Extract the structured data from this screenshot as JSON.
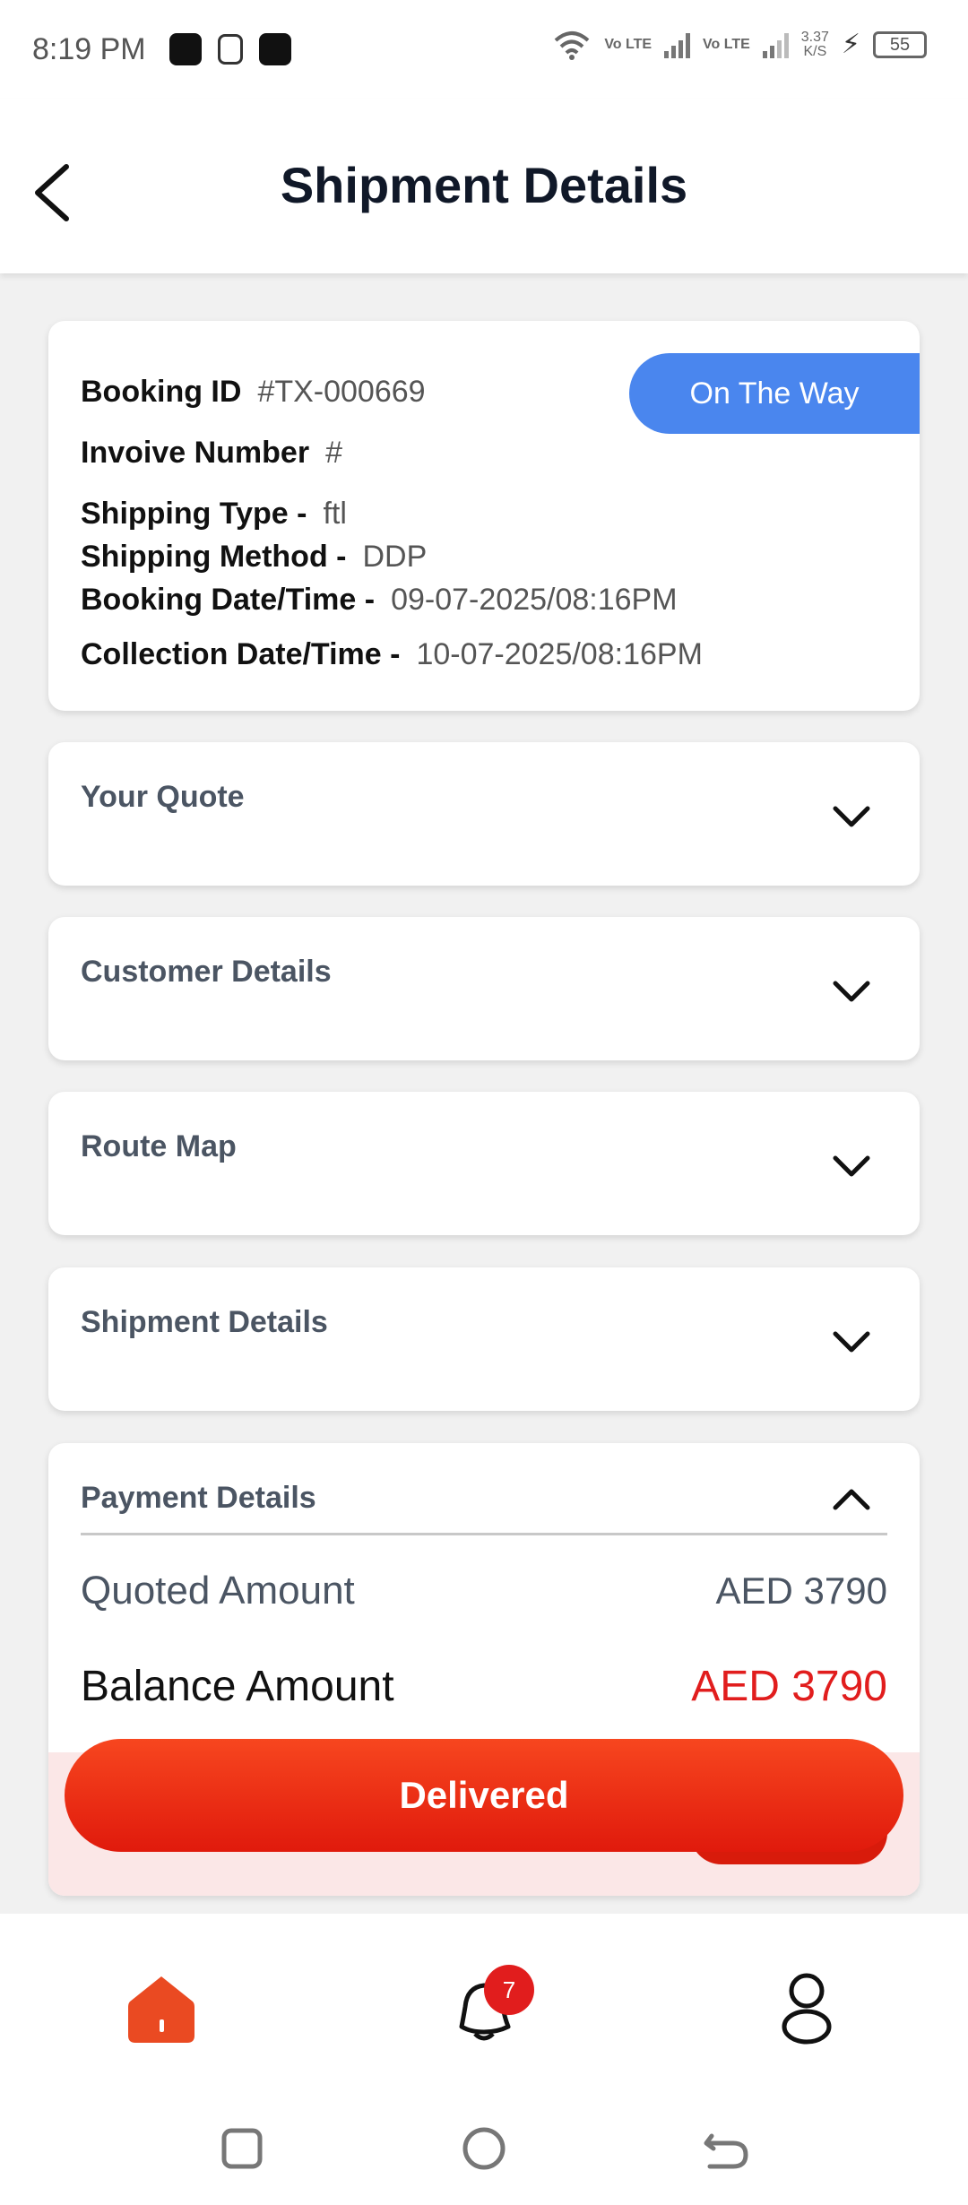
{
  "status_bar": {
    "time": "8:19 PM",
    "network_speed": "3.37",
    "network_speed_unit": "K/S",
    "battery": "55",
    "lte_label_1": "Vo LTE",
    "lte_label_2": "Vo LTE"
  },
  "header": {
    "title": "Shipment Details"
  },
  "booking": {
    "booking_id_label": "Booking ID",
    "booking_id_value": "#TX-000669",
    "invoice_label": "Invoive Number",
    "invoice_value": "#",
    "shipping_type_label": "Shipping Type -",
    "shipping_type_value": "ftl",
    "shipping_method_label": "Shipping Method -",
    "shipping_method_value": "DDP",
    "booking_dt_label": "Booking Date/Time -",
    "booking_dt_value": "09-07-2025/08:16PM",
    "collection_dt_label": "Collection Date/Time -",
    "collection_dt_value": "10-07-2025/08:16PM",
    "status": "On The Way",
    "status_color": "#4a86ee"
  },
  "sections": {
    "your_quote": "Your Quote",
    "customer_details": "Customer Details",
    "route_map": "Route Map",
    "shipment_details": "Shipment Details"
  },
  "payment": {
    "title": "Payment Details",
    "quoted_label": "Quoted Amount",
    "quoted_value": "AED 3790",
    "balance_label": "Balance Amount",
    "balance_value": "AED 3790",
    "balance_color": "#e11d1d"
  },
  "actions": {
    "delivered_label": "Delivered",
    "accent": "#f24a1c"
  },
  "nav": {
    "notification_count": "7"
  }
}
